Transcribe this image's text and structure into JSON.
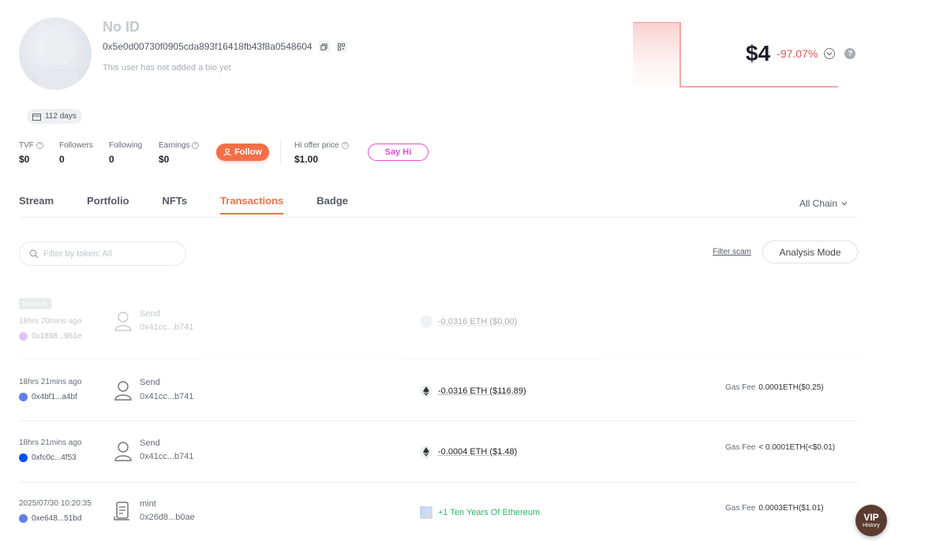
{
  "profile": {
    "name": "No ID",
    "address": "0x5e0d00730f0905cda893f16418fb43f8a0548604",
    "bio": "This user has not added a bio yet",
    "days": "112 days"
  },
  "stats": {
    "tvf_label": "TVF",
    "tvf_value": "$0",
    "followers_label": "Followers",
    "followers_value": "0",
    "following_label": "Following",
    "following_value": "0",
    "earnings_label": "Earnings",
    "earnings_value": "$0",
    "follow_button": "Follow",
    "hi_offer_label": "Hi offer price",
    "hi_offer_value": "$1.00",
    "sayhi_button": "Say Hi"
  },
  "value": {
    "amount": "$4",
    "change": "-97.07%",
    "help": "?",
    "colors": {
      "negative": "#ec5454"
    }
  },
  "tabs": {
    "items": [
      "Stream",
      "Portfolio",
      "NFTs",
      "Transactions",
      "Badge"
    ],
    "active": "Transactions",
    "chain_select": "All Chain"
  },
  "filter": {
    "placeholder": "Filter by token: All",
    "filter_scam": "Filter scam",
    "analysis_mode": "Analysis Mode"
  },
  "transactions": [
    {
      "scam_tag": "Scam tx",
      "time": "18hrs 20mins ago",
      "hash": "0x1898...961e",
      "chain_color": "#a56cf0",
      "type": "Send",
      "address": "0x41cc...b741",
      "token_icon": "generic-token-icon",
      "amount": "-0.0316 ETH ($0.00)",
      "gas_label": "",
      "gas_value": ""
    },
    {
      "time": "18hrs 21mins ago",
      "hash": "0x4bf1...a4bf",
      "chain_color": "#627eea",
      "type": "Send",
      "address": "0x41cc...b741",
      "token_icon": "eth-icon",
      "amount": "-0.0316 ETH ($116.89)",
      "gas_label": "Gas Fee",
      "gas_value": "0.0001ETH($0.25)"
    },
    {
      "time": "18hrs 21mins ago",
      "hash": "0xfc0c...4f53",
      "chain_color": "#0052ff",
      "type": "Send",
      "address": "0x41cc...b741",
      "token_icon": "eth-icon",
      "amount": "-0.0004 ETH ($1.48)",
      "gas_label": "Gas Fee",
      "gas_value": "< 0.0001ETH(<$0.01)"
    },
    {
      "time": "2025/07/30 10:20:35",
      "hash": "0xe648...51bd",
      "chain_color": "#627eea",
      "type": "mint",
      "address": "0x26d8...b0ae",
      "token_icon": "nft-thumbnail",
      "amount": "+1 Ten Years Of Ethereum",
      "gas_label": "Gas Fee",
      "gas_value": "0.0003ETH($1.01)"
    }
  ],
  "vip": {
    "title": "VIP",
    "subtitle": "History"
  },
  "colors": {
    "accent": "#f46f47",
    "sayhi": "#e94bd6",
    "positive": "#25b864"
  }
}
